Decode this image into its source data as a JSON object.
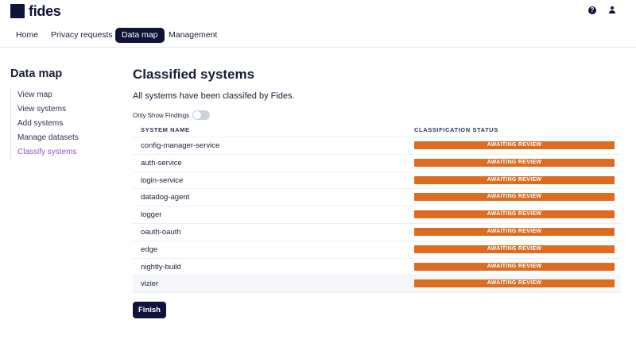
{
  "header": {
    "logo_text": "fides",
    "help_glyph": "?",
    "icons": {
      "help": "help-circle-icon",
      "user": "user-icon"
    }
  },
  "nav": {
    "items": [
      {
        "label": "Home"
      },
      {
        "label": "Privacy requests"
      },
      {
        "label": "Data map",
        "active": true
      },
      {
        "label": "Management"
      }
    ]
  },
  "sidebar": {
    "title": "Data map",
    "items": [
      {
        "label": "View map"
      },
      {
        "label": "View systems"
      },
      {
        "label": "Add systems"
      },
      {
        "label": "Manage datasets"
      },
      {
        "label": "Classify systems",
        "active": true
      }
    ]
  },
  "main": {
    "title": "Classified systems",
    "subtitle": "All systems have been classifed by Fides.",
    "toggle_label": "Only Show Findings",
    "toggle_on": false,
    "table": {
      "headers": [
        "SYSTEM NAME",
        "CLASSIFICATION STATUS"
      ],
      "rows": [
        {
          "name": "config-manager-service",
          "status": "AWAITING REVIEW"
        },
        {
          "name": "auth-service",
          "status": "AWAITING REVIEW"
        },
        {
          "name": "login-service",
          "status": "AWAITING REVIEW"
        },
        {
          "name": "datadog-agent",
          "status": "AWAITING REVIEW"
        },
        {
          "name": "logger",
          "status": "AWAITING REVIEW"
        },
        {
          "name": "oauth-oauth",
          "status": "AWAITING REVIEW"
        },
        {
          "name": "edge",
          "status": "AWAITING REVIEW"
        },
        {
          "name": "nightly-build",
          "status": "AWAITING REVIEW"
        },
        {
          "name": "vizier",
          "status": "AWAITING REVIEW"
        }
      ]
    },
    "finish_label": "Finish"
  },
  "colors": {
    "brand": "#11143a",
    "status_awaiting": "#dd6b20",
    "sidebar_active": "#8f52d6"
  }
}
